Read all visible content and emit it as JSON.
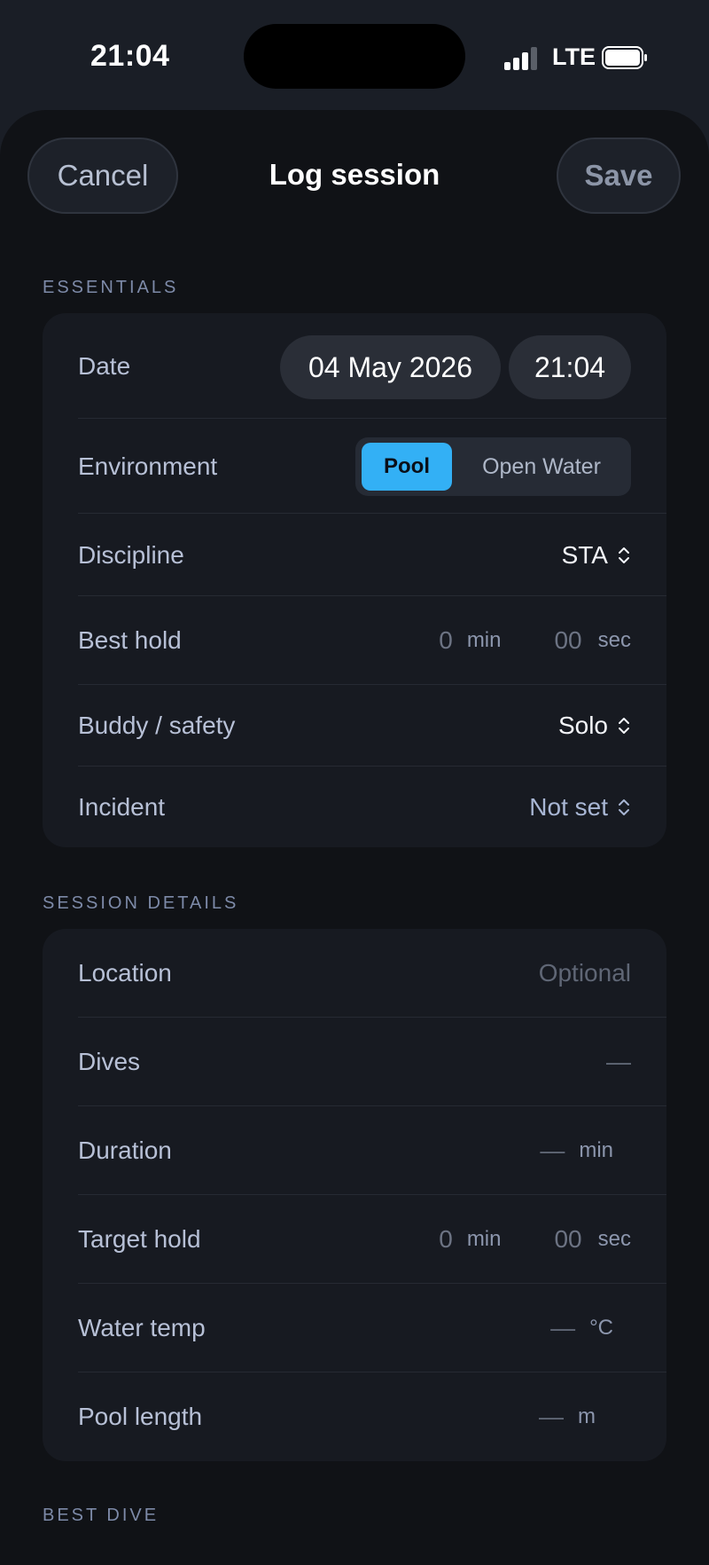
{
  "status_bar": {
    "time": "21:04",
    "network": "LTE"
  },
  "header": {
    "cancel_label": "Cancel",
    "title": "Log session",
    "save_label": "Save"
  },
  "essentials": {
    "heading": "ESSENTIALS",
    "date_label": "Date",
    "date_value": "04 May 2026",
    "time_value": "21:04",
    "environment_label": "Environment",
    "environment_options": [
      "Pool",
      "Open Water"
    ],
    "environment_selected": "Pool",
    "discipline_label": "Discipline",
    "discipline_value": "STA",
    "best_hold_label": "Best hold",
    "best_hold_min": "0",
    "best_hold_min_unit": "min",
    "best_hold_sec": "00",
    "best_hold_sec_unit": "sec",
    "buddy_label": "Buddy / safety",
    "buddy_value": "Solo",
    "incident_label": "Incident",
    "incident_value": "Not set"
  },
  "session_details": {
    "heading": "SESSION DETAILS",
    "location_label": "Location",
    "location_placeholder": "Optional",
    "dives_label": "Dives",
    "dives_value": "—",
    "duration_label": "Duration",
    "duration_value": "—",
    "duration_unit": "min",
    "target_hold_label": "Target hold",
    "target_hold_min": "0",
    "target_hold_min_unit": "min",
    "target_hold_sec": "00",
    "target_hold_sec_unit": "sec",
    "water_temp_label": "Water temp",
    "water_temp_value": "—",
    "water_temp_unit": "°C",
    "pool_length_label": "Pool length",
    "pool_length_value": "—",
    "pool_length_unit": "m"
  },
  "best_dive": {
    "heading": "BEST DIVE"
  },
  "colors": {
    "accent": "#33b0f5",
    "background": "#101216",
    "card": "#171a21"
  }
}
